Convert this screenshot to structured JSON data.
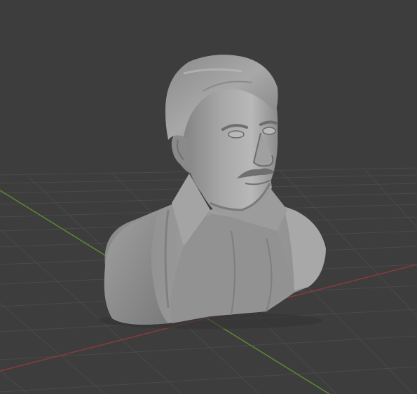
{
  "viewport": {
    "background": "#3d3d3d",
    "grid_color": "#4a4a4a",
    "x_axis_color": "#8a3a3a",
    "y_axis_color": "#5d8a2e",
    "object": {
      "name": "bust-sculpt-mesh",
      "material_color": "#9a9a9a",
      "shading": "solid-matcap-grey"
    }
  }
}
